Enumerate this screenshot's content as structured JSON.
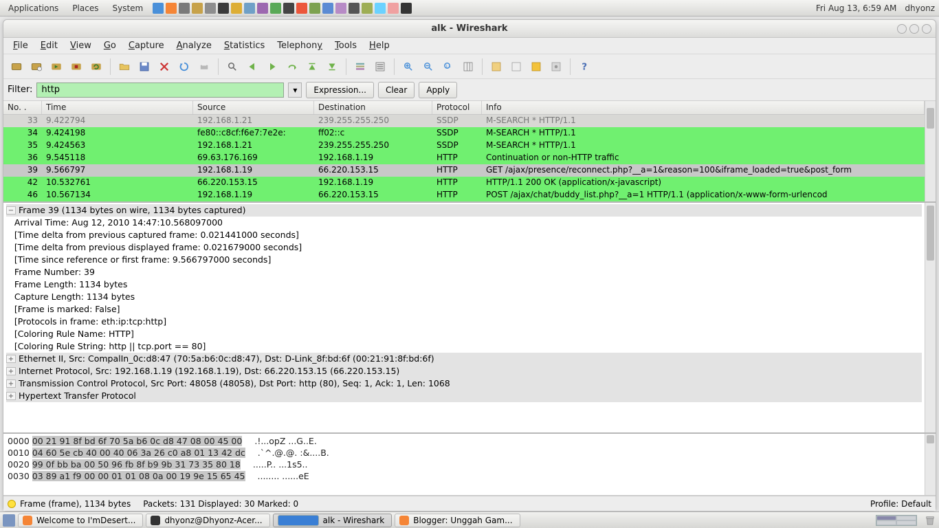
{
  "gnome": {
    "apps": "Applications",
    "places": "Places",
    "system": "System",
    "clock": "Fri Aug 13,  6:59 AM",
    "user": "dhyonz"
  },
  "window": {
    "title": "alk - Wireshark"
  },
  "menu": {
    "file": "File",
    "edit": "Edit",
    "view": "View",
    "go": "Go",
    "capture": "Capture",
    "analyze": "Analyze",
    "statistics": "Statistics",
    "telephony": "Telephony",
    "tools": "Tools",
    "help": "Help"
  },
  "filter": {
    "label": "Filter:",
    "value": "http",
    "expression": "Expression...",
    "clear": "Clear",
    "apply": "Apply"
  },
  "columns": {
    "no": "No. .",
    "time": "Time",
    "src": "Source",
    "dst": "Destination",
    "proto": "Protocol",
    "info": "Info"
  },
  "packets": [
    {
      "no": "33",
      "time": "9.422794",
      "src": "192.168.1.21",
      "dst": "239.255.255.250",
      "proto": "SSDP",
      "info": "M-SEARCH * HTTP/1.1",
      "cls": "row-clip"
    },
    {
      "no": "34",
      "time": "9.424198",
      "src": "fe80::c8cf:f6e7:7e2e:",
      "dst": "ff02::c",
      "proto": "SSDP",
      "info": "M-SEARCH * HTTP/1.1",
      "cls": "row-green"
    },
    {
      "no": "35",
      "time": "9.424563",
      "src": "192.168.1.21",
      "dst": "239.255.255.250",
      "proto": "SSDP",
      "info": "M-SEARCH * HTTP/1.1",
      "cls": "row-green"
    },
    {
      "no": "36",
      "time": "9.545118",
      "src": "69.63.176.169",
      "dst": "192.168.1.19",
      "proto": "HTTP",
      "info": "Continuation or non-HTTP traffic",
      "cls": "row-green"
    },
    {
      "no": "39",
      "time": "9.566797",
      "src": "192.168.1.19",
      "dst": "66.220.153.15",
      "proto": "HTTP",
      "info": "GET /ajax/presence/reconnect.php?__a=1&reason=100&iframe_loaded=true&post_form",
      "cls": "row-sel"
    },
    {
      "no": "42",
      "time": "10.532761",
      "src": "66.220.153.15",
      "dst": "192.168.1.19",
      "proto": "HTTP",
      "info": "HTTP/1.1 200 OK  (application/x-javascript)",
      "cls": "row-green"
    },
    {
      "no": "46",
      "time": "10.567134",
      "src": "192.168.1.19",
      "dst": "66.220.153.15",
      "proto": "HTTP",
      "info": "POST /ajax/chat/buddy_list.php?__a=1 HTTP/1.1  (application/x-www-form-urlencod",
      "cls": "row-green"
    }
  ],
  "details": {
    "frame_hdr": "Frame 39 (1134 bytes on wire, 1134 bytes captured)",
    "lines": [
      "   Arrival Time: Aug 12, 2010 14:47:10.568097000",
      "   [Time delta from previous captured frame: 0.021441000 seconds]",
      "   [Time delta from previous displayed frame: 0.021679000 seconds]",
      "   [Time since reference or first frame: 9.566797000 seconds]",
      "   Frame Number: 39",
      "   Frame Length: 1134 bytes",
      "   Capture Length: 1134 bytes",
      "   [Frame is marked: False]",
      "   [Protocols in frame: eth:ip:tcp:http]",
      "   [Coloring Rule Name: HTTP]",
      "   [Coloring Rule String: http || tcp.port == 80]"
    ],
    "eth": "Ethernet II, Src: CompalIn_0c:d8:47 (70:5a:b6:0c:d8:47), Dst: D-Link_8f:bd:6f (00:21:91:8f:bd:6f)",
    "ip": "Internet Protocol, Src: 192.168.1.19 (192.168.1.19), Dst: 66.220.153.15 (66.220.153.15)",
    "tcp": "Transmission Control Protocol, Src Port: 48058 (48058), Dst Port: http (80), Seq: 1, Ack: 1, Len: 1068",
    "http": "Hypertext Transfer Protocol"
  },
  "hex": [
    {
      "off": "0000",
      "hex": "00 21 91 8f bd 6f 70 5a  b6 0c d8 47 08 00 45 00",
      "asc": ".!...opZ ...G..E."
    },
    {
      "off": "0010",
      "hex": "04 60 5e cb 40 00 40 06  3a 26 c0 a8 01 13 42 dc",
      "asc": ".`^.@.@. :&....B."
    },
    {
      "off": "0020",
      "hex": "99 0f bb ba 00 50 96 fb  8f b9 9b 31 73 35 80 18",
      "asc": ".....P.. ...1s5.."
    },
    {
      "off": "0030",
      "hex": "03 89 a1 f9 00 00 01 01  08 0a 00 19 9e 15 65 45",
      "asc": "........ ......eE"
    }
  ],
  "status": {
    "frame": "Frame (frame), 1134 bytes",
    "packets": "Packets: 131 Displayed: 30 Marked: 0",
    "profile": "Profile: Default"
  },
  "taskbar": {
    "t1": "Welcome to I'mDesert...",
    "t2": "dhyonz@Dhyonz-Acer...",
    "t3": "alk - Wireshark",
    "t4": "Blogger: Unggah Gam..."
  }
}
